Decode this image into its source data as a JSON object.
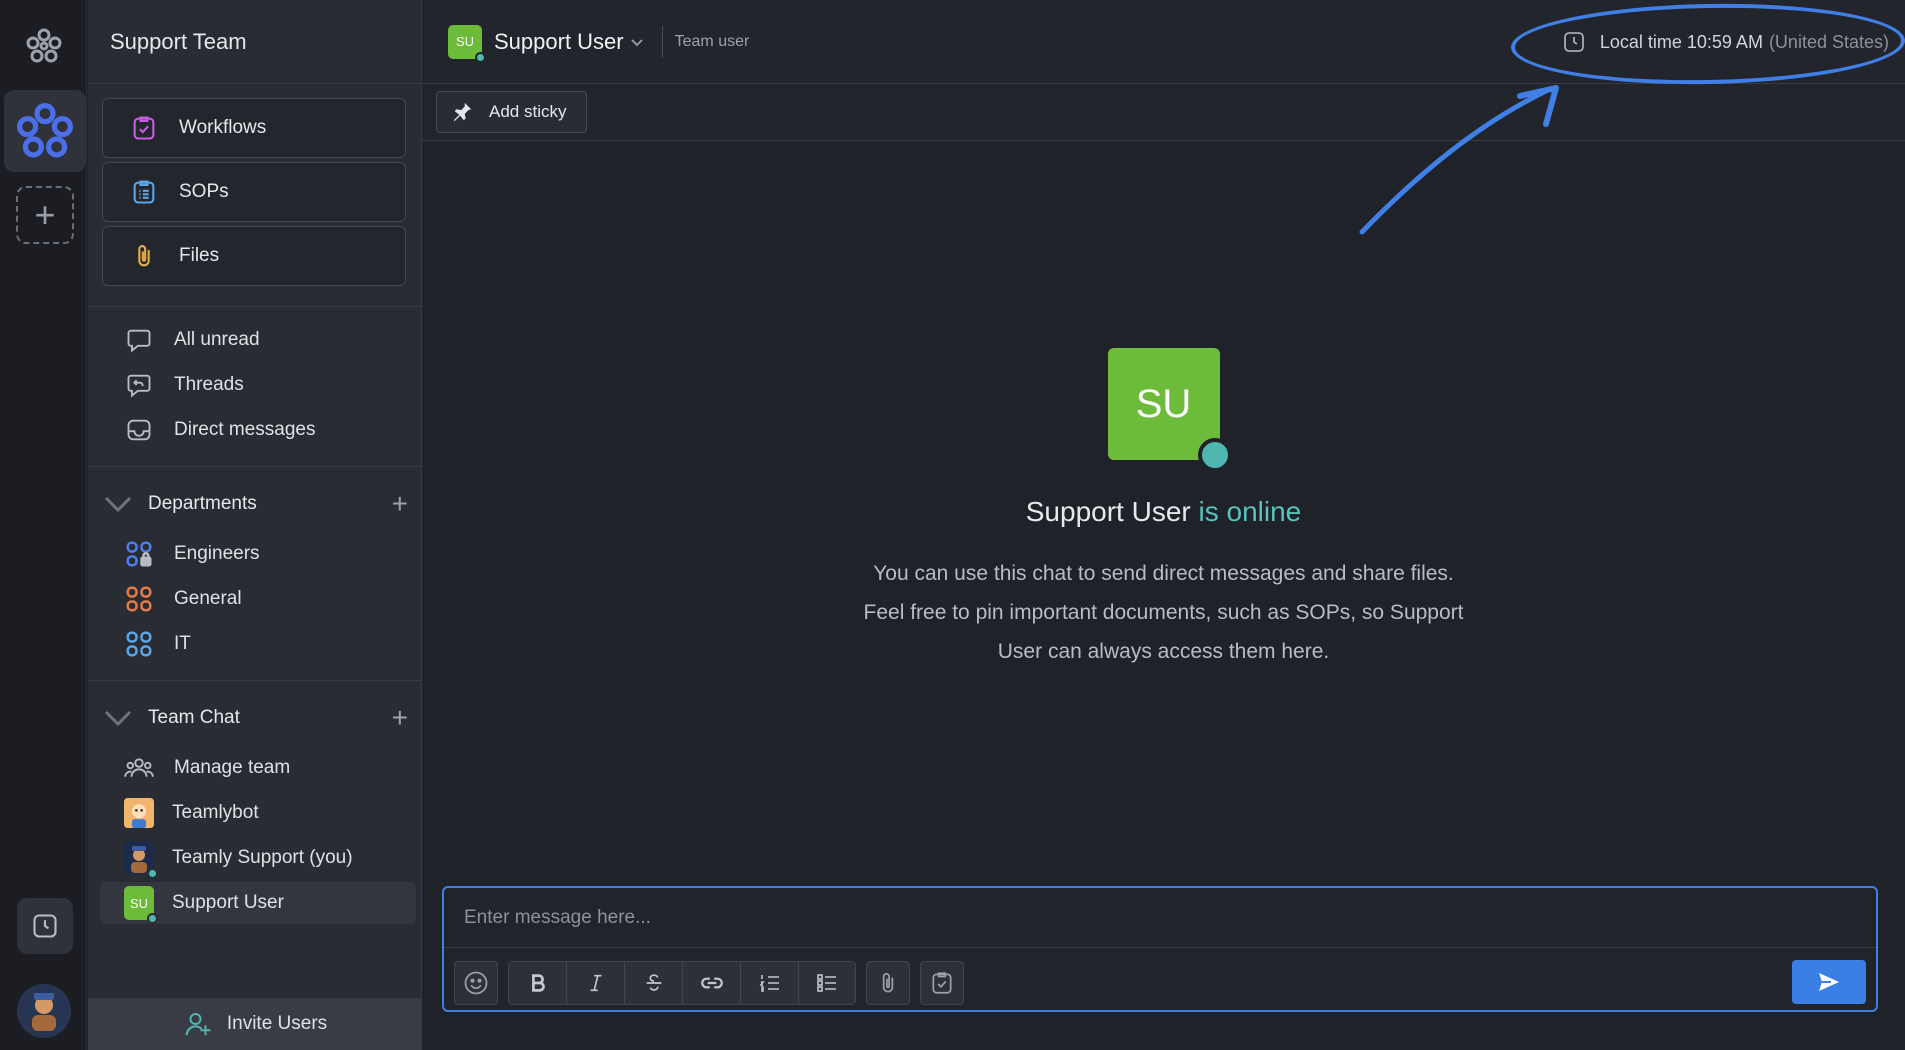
{
  "sidebar": {
    "team_name": "Support Team",
    "tools": [
      {
        "label": "Workflows",
        "icon": "workflow-icon"
      },
      {
        "label": "SOPs",
        "icon": "clipboard-list-icon"
      },
      {
        "label": "Files",
        "icon": "paperclip-icon"
      }
    ],
    "nav": [
      {
        "label": "All unread",
        "icon": "chat-bubble-icon"
      },
      {
        "label": "Threads",
        "icon": "thread-reply-icon"
      },
      {
        "label": "Direct messages",
        "icon": "inbox-icon"
      }
    ],
    "departments": {
      "title": "Departments",
      "items": [
        {
          "label": "Engineers",
          "color": "#4e7fe8",
          "locked": true
        },
        {
          "label": "General",
          "color": "#e27d47"
        },
        {
          "label": "IT",
          "color": "#5aa6e6"
        }
      ]
    },
    "team_chat": {
      "title": "Team Chat",
      "items": [
        {
          "label": "Manage team"
        },
        {
          "label": "Teamlybot"
        },
        {
          "label": "Teamly Support (you)"
        },
        {
          "label": "Support User",
          "initials": "SU"
        }
      ]
    },
    "invite_label": "Invite Users"
  },
  "header": {
    "initials": "SU",
    "user_name": "Support User",
    "role": "Team user",
    "local_time_label": "Local time 10:59 AM",
    "local_time_country": "(United States)"
  },
  "sticky": {
    "label": "Add sticky"
  },
  "welcome": {
    "initials": "SU",
    "name": "Support User",
    "status": "is online",
    "description": "You can use this chat to send direct messages and share files. Feel free to pin important documents, such as SOPs, so Support User can always access them here."
  },
  "composer": {
    "placeholder": "Enter message here..."
  },
  "colors": {
    "accent": "#3f7fe6",
    "online": "#4fb6b0",
    "avatar_green": "#6dbb3a"
  }
}
